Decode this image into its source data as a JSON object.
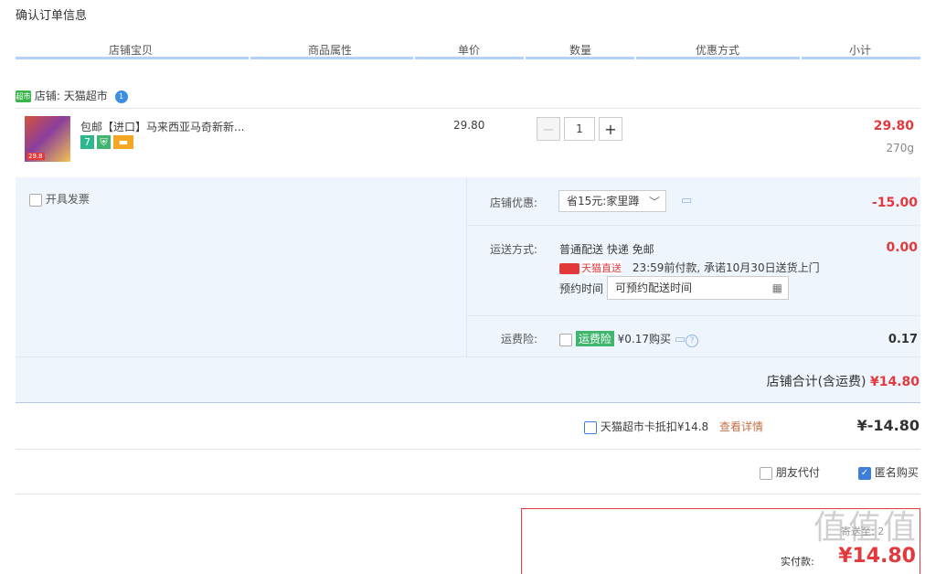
{
  "page_title": "确认订单信息",
  "columns": [
    "店铺宝贝",
    "商品属性",
    "单价",
    "数量",
    "优惠方式",
    "小计"
  ],
  "shop": {
    "prefix": "店铺:",
    "name": "天猫超市",
    "logo_text": "超市",
    "badge": "1"
  },
  "item": {
    "title": "包邮【进口】马来西亚马奇新新...",
    "price": "29.80",
    "quantity": "1",
    "minus": "−",
    "plus": "+",
    "subtotal": "29.80",
    "weight": "270g",
    "image_tag": "29.8",
    "tag_seven": "7"
  },
  "invoice_label": "开具发票",
  "shop_discount": {
    "label": "店铺优惠:",
    "value": "省15元:家里蹲",
    "amount": "-15.00"
  },
  "shipping": {
    "label": "运送方式:",
    "method": "普通配送 快递 免邮",
    "tmall_express": "天猫直送",
    "promise": "23:59前付款, 承诺10月30日送货上门",
    "reserve_label": "预约时间",
    "reserve_placeholder": "可预约配送时间",
    "amount": "0.00"
  },
  "insurance": {
    "label": "运费险:",
    "tag": "运费险",
    "text": "¥0.17购买",
    "amount": "0.17"
  },
  "shop_total": {
    "label": "店铺合计(含运费)",
    "amount": "¥14.80"
  },
  "card_deduct": {
    "text": "天猫超市卡抵扣¥14.8",
    "link": "查看详情",
    "amount": "¥-14.80"
  },
  "friend_pay": "朋友代付",
  "anonymous": "匿名购买",
  "final": {
    "label": "实付款:",
    "amount": "¥14.80",
    "partial_text": "寄送至: 2"
  },
  "watermark": "值值值",
  "colors": {
    "accent_red": "#e4393c",
    "header_bar": "#b2d1ff",
    "panel_bg": "#eef5fd"
  }
}
